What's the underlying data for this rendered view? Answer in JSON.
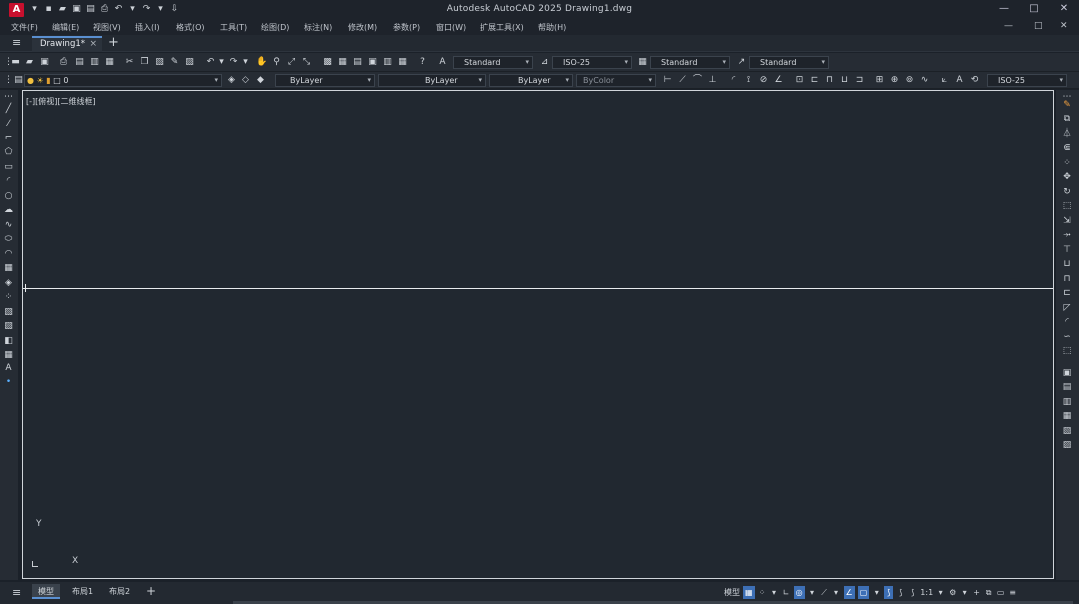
{
  "app": {
    "logo_letter": "A",
    "title": "Autodesk AutoCAD 2025    Drawing1.dwg",
    "window_controls": [
      "—",
      "□",
      "✕"
    ]
  },
  "menubar": {
    "items": [
      "文件(F)",
      "编辑(E)",
      "视图(V)",
      "插入(I)",
      "格式(O)",
      "工具(T)",
      "绘图(D)",
      "标注(N)",
      "修改(M)",
      "参数(P)",
      "窗口(W)",
      "扩展工具(X)",
      "帮助(H)"
    ],
    "mdi_controls": [
      "—",
      "□",
      "✕"
    ]
  },
  "tabs": {
    "document_tab": "Drawing1*",
    "close": "×",
    "new_tab": "+"
  },
  "toolbar1": {
    "text_style": "Standard",
    "dim_style": "ISO-25",
    "table_style": "Standard",
    "mleader_style": "Standard"
  },
  "toolbar2": {
    "layer": "0",
    "color": "ByLayer",
    "linetype": "ByLayer",
    "lineweight": "ByLayer",
    "plotstyle": "ByColor",
    "dim_style": "ISO-25"
  },
  "canvas": {
    "view_label": "[-][俯视][二维线框]",
    "ucs_y": "Y",
    "ucs_x": "X"
  },
  "layout_tabs": {
    "items": [
      "模型",
      "布局1",
      "布局2"
    ],
    "active": "模型",
    "add": "+"
  },
  "status_bar": {
    "model_label": "模型",
    "scale": "1:1"
  },
  "colors": {
    "canvas_bg": "#212830",
    "accent": "#3d6fb5",
    "logo": "#c8102e"
  }
}
